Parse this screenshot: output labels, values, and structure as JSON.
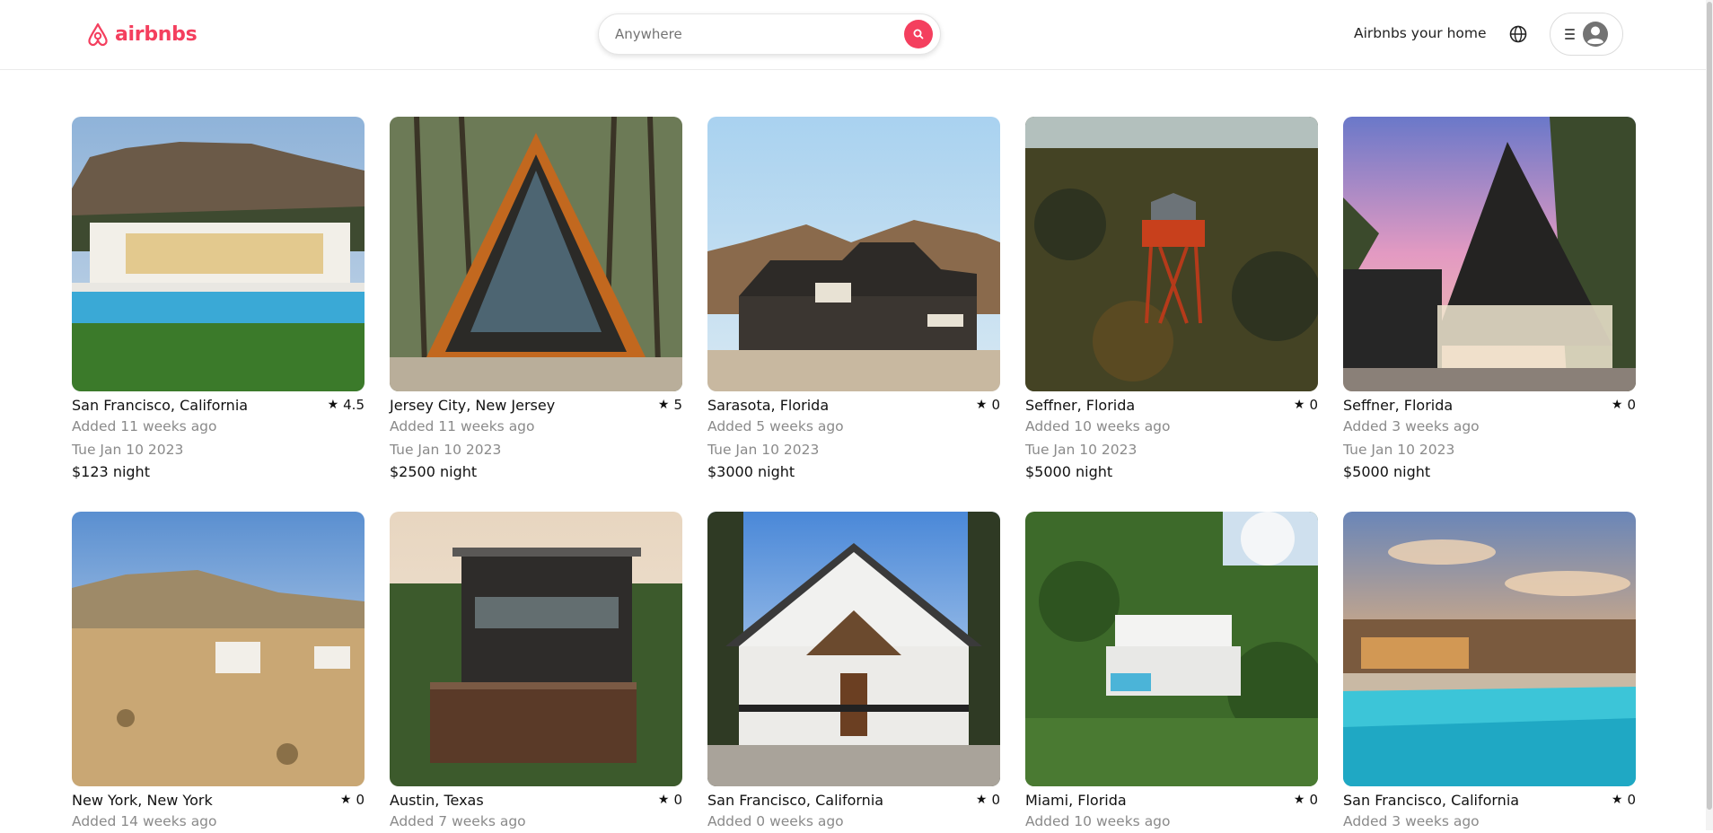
{
  "brand": {
    "name": "airbnbs",
    "color": "#f43f5e"
  },
  "search": {
    "placeholder": "Anywhere",
    "button_icon": "search-icon"
  },
  "nav": {
    "host_label": "Airbnbs your home",
    "globe_icon": "globe-icon",
    "menu_icon": "hamburger-icon",
    "avatar_icon": "user-avatar-icon"
  },
  "listings": [
    {
      "location": "San Francisco, California",
      "rating": "4.5",
      "added": "Added 11 weeks ago",
      "date": "Tue Jan 10 2023",
      "price": "$123",
      "price_suffix": "night",
      "scene": "modern-villa-pool-mountain"
    },
    {
      "location": "Jersey City, New Jersey",
      "rating": "5",
      "added": "Added 11 weeks ago",
      "date": "Tue Jan 10 2023",
      "price": "$2500",
      "price_suffix": "night",
      "scene": "a-frame-forest"
    },
    {
      "location": "Sarasota, Florida",
      "rating": "0",
      "added": "Added 5 weeks ago",
      "date": "Tue Jan 10 2023",
      "price": "$3000",
      "price_suffix": "night",
      "scene": "dark-house-hills"
    },
    {
      "location": "Seffner, Florida",
      "rating": "0",
      "added": "Added 10 weeks ago",
      "date": "Tue Jan 10 2023",
      "price": "$5000",
      "price_suffix": "night",
      "scene": "fire-tower-forest"
    },
    {
      "location": "Seffner, Florida",
      "rating": "0",
      "added": "Added 3 weeks ago",
      "date": "Tue Jan 10 2023",
      "price": "$5000",
      "price_suffix": "night",
      "scene": "black-a-frame-sunset"
    },
    {
      "location": "New York, New York",
      "rating": "0",
      "added": "Added 14 weeks ago",
      "scene": "desert-homes"
    },
    {
      "location": "Austin, Texas",
      "rating": "0",
      "added": "Added 7 weeks ago",
      "scene": "house-deck-garden"
    },
    {
      "location": "San Francisco, California",
      "rating": "0",
      "added": "Added 0 weeks ago",
      "scene": "white-farmhouse"
    },
    {
      "location": "Miami, Florida",
      "rating": "0",
      "added": "Added 10 weeks ago",
      "scene": "jungle-villa"
    },
    {
      "location": "San Francisco, California",
      "rating": "0",
      "added": "Added 3 weeks ago",
      "scene": "adobe-pool-sunset"
    }
  ]
}
